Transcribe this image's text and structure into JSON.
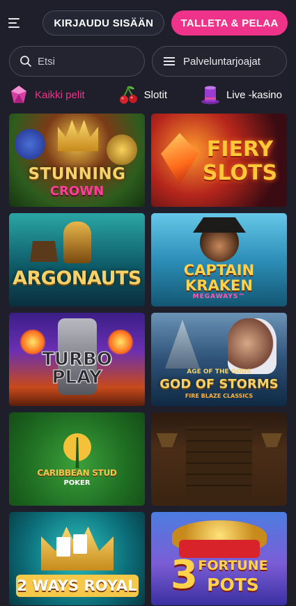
{
  "header": {
    "menu_icon": "hamburger-icon",
    "login_label": "KIRJAUDU SISÄÄN",
    "deposit_label": "TALLETA & PELAA",
    "accent_color": "#f0338a"
  },
  "search": {
    "placeholder": "Etsi",
    "icon": "search-icon",
    "providers_label": "Palveluntarjoajat"
  },
  "categories": [
    {
      "label": "Kaikki pelit",
      "icon": "gem-icon",
      "active": true
    },
    {
      "label": "Slotit",
      "icon": "cherry-icon",
      "active": false
    },
    {
      "label": "Live -kasino",
      "icon": "top-hat-icon",
      "active": false
    }
  ],
  "games": [
    {
      "title_line1": "STUNNING",
      "title_line2": "CROWN"
    },
    {
      "title_line1": "FIERY",
      "title_line2": "SLOTS"
    },
    {
      "title_line1": "ARGONAUTS",
      "title_line2": ""
    },
    {
      "title_line1": "CAPTAIN",
      "title_line2": "KRAKEN",
      "subtitle": "MEGAWAYS™"
    },
    {
      "title_line1": "TURBO",
      "title_line2": "PLAY"
    },
    {
      "title_line1": "AGE OF THE GODS",
      "title_line2": "GOD OF STORMS",
      "subtitle": "FIRE BLAZE CLASSICS"
    },
    {
      "title_line1": "CARIBBEAN STUD",
      "title_line2": "POKER"
    },
    {
      "title_line1": "",
      "title_line2": ""
    },
    {
      "title_line1": "2 WAYS ROYAL",
      "title_line2": ""
    },
    {
      "title_line1": "3",
      "title_line2": "FORTUNE",
      "subtitle": "POTS"
    }
  ]
}
